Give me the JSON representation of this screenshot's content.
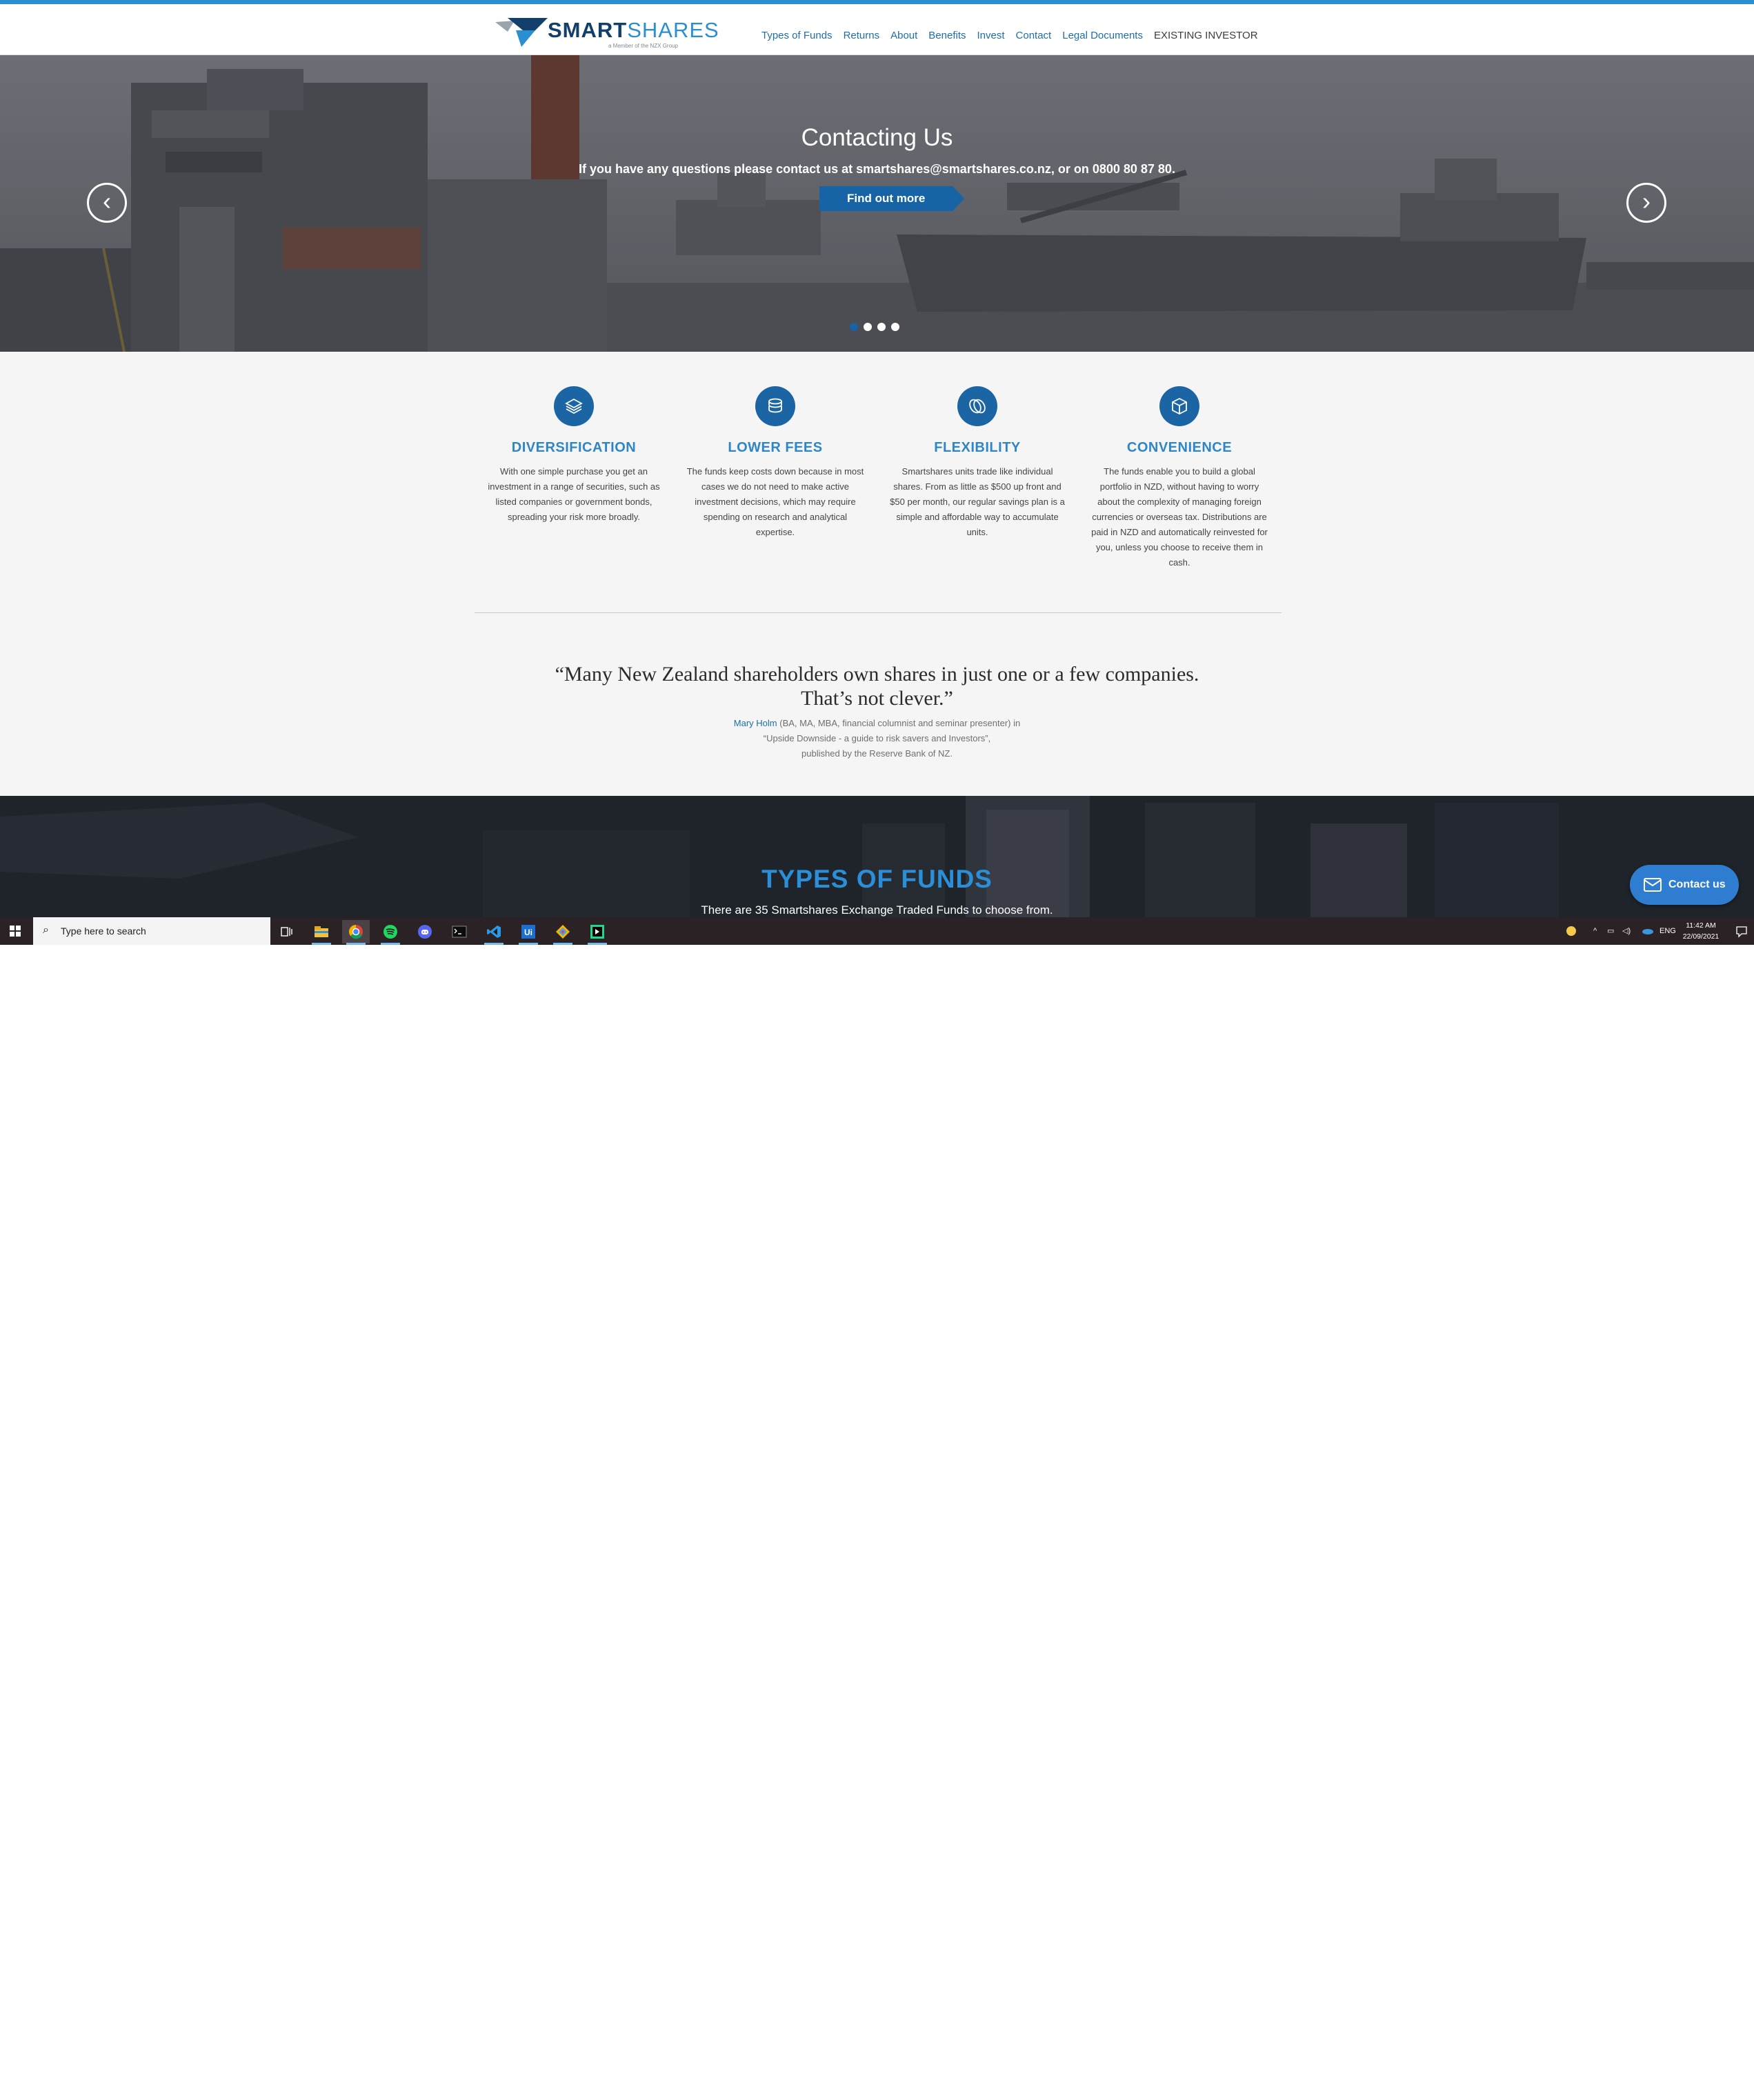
{
  "header": {
    "logo": {
      "brand_bold": "SMART",
      "brand_light": "SHARES",
      "tagline": "a Member of the NZX Group"
    },
    "nav": [
      {
        "label": "Types of Funds"
      },
      {
        "label": "Returns"
      },
      {
        "label": "About"
      },
      {
        "label": "Benefits"
      },
      {
        "label": "Invest"
      },
      {
        "label": "Contact"
      },
      {
        "label": "Legal Documents"
      },
      {
        "label": "EXISTING INVESTOR"
      }
    ]
  },
  "hero": {
    "title": "Contacting Us",
    "subtitle": "If you have any questions please contact us at smartshares@smartshares.co.nz, or on 0800 80 87 80.",
    "button_label": "Find out more",
    "prev_icon": "chevron-left-icon",
    "next_icon": "chevron-right-icon",
    "slides_total": 4,
    "active_slide": 1
  },
  "benefits": [
    {
      "icon": "stack-layers-icon",
      "title": "DIVERSIFICATION",
      "text": "With one simple purchase you get an investment in a range of securities, such as listed companies or government bonds, spreading your risk more broadly."
    },
    {
      "icon": "coin-stack-icon",
      "title": "LOWER FEES",
      "text": "The funds keep costs down because in most cases we do not need to make active investment decisions, which may require spending on research and analytical expertise."
    },
    {
      "icon": "interlinked-rings-icon",
      "title": "FLEXIBILITY",
      "text": "Smartshares units trade like individual shares. From as little as $500 up front and $50 per month, our regular savings plan is a simple and affordable way to accumulate units."
    },
    {
      "icon": "cube-icon",
      "title": "CONVENIENCE",
      "text": "The funds enable you to build a global portfolio in NZD, without having to worry about the complexity of managing foreign currencies or overseas tax. Distributions are paid in NZD and automatically reinvested for you, unless you choose to receive them in cash."
    }
  ],
  "quote": {
    "line1": "“Many New Zealand shareholders own shares in just one or a few companies.",
    "line2": "That’s not clever.”",
    "author": "Mary Holm",
    "author_detail": " (BA, MA, MBA, financial columnist and seminar presenter) in",
    "source": "“Upside Downside - a guide to risk savers and Investors”,",
    "publisher": "published by the Reserve Bank of NZ."
  },
  "funds": {
    "title": "TYPES OF FUNDS",
    "subtitle": "There are 35 Smartshares Exchange Traded Funds to choose from."
  },
  "contact_widget": {
    "label": "Contact us",
    "icon": "envelope-icon"
  },
  "taskbar": {
    "search_placeholder": "Type here to search",
    "apps": [
      {
        "name": "task-view-icon"
      },
      {
        "name": "file-explorer-icon"
      },
      {
        "name": "chrome-icon"
      },
      {
        "name": "spotify-icon"
      },
      {
        "name": "discord-icon"
      },
      {
        "name": "terminal-icon"
      },
      {
        "name": "vscode-icon"
      },
      {
        "name": "uipath-icon"
      },
      {
        "name": "git-icon"
      },
      {
        "name": "pycharm-icon"
      }
    ],
    "language": "ENG",
    "time": "11:42 AM",
    "date": "22/09/2021"
  }
}
